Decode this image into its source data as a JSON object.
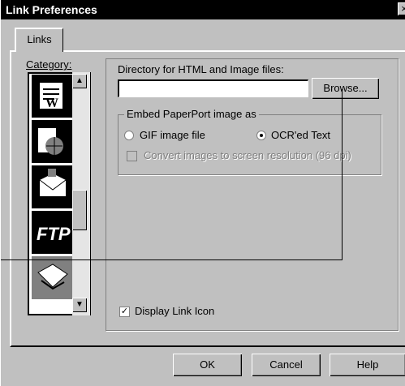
{
  "window": {
    "title": "Link Preferences",
    "close_glyph": "×"
  },
  "tabs": [
    {
      "label": "Links"
    }
  ],
  "category": {
    "label": "Category:",
    "items": [
      {
        "name": "word-document-icon"
      },
      {
        "name": "globe-icon"
      },
      {
        "name": "mail-icon"
      },
      {
        "name": "ftp-icon",
        "text": "FTP"
      },
      {
        "name": "paperport-link-icon"
      }
    ],
    "selected_index": 4
  },
  "directory": {
    "label": "Directory for HTML and Image files:",
    "value": "",
    "browse_label": "Browse..."
  },
  "embed": {
    "group_label": "Embed PaperPort image as",
    "options": [
      {
        "label": "GIF image file",
        "selected": false
      },
      {
        "label": "OCR'ed Text",
        "selected": true
      }
    ],
    "convert_label": "Convert images to screen resolution (96 dpi)",
    "convert_checked": false,
    "convert_enabled": false
  },
  "display_link_icon": {
    "label": "Display Link Icon",
    "checked": true
  },
  "buttons": {
    "ok": "OK",
    "cancel": "Cancel",
    "help": "Help"
  }
}
